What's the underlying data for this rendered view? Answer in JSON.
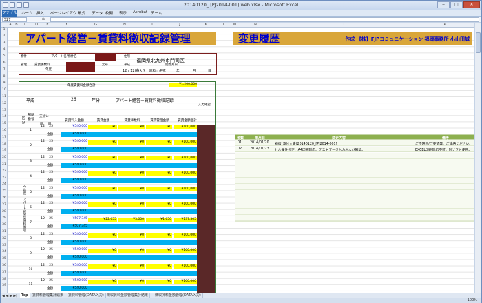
{
  "window": {
    "title": "20140120_ [PJ2014-001] web.xlsx - Microsoft Excel"
  },
  "menu": {
    "file": "ファイル",
    "items": [
      "ホーム",
      "挿入",
      "ページレイアウト",
      "数式",
      "データ",
      "校閲",
      "表示",
      "Acrobat",
      "チーム"
    ]
  },
  "formula_bar": {
    "name_box": "S27",
    "fx": "fx",
    "value": ""
  },
  "columns": [
    "A",
    "B",
    "C",
    "D",
    "E",
    "F",
    "G",
    "H",
    "I",
    "J",
    "K",
    "L",
    "M",
    "N",
    "O",
    "P"
  ],
  "rows": [
    "1",
    "2",
    "3",
    "4",
    "5",
    "6",
    "7",
    "8",
    "9",
    "10",
    "11",
    "12",
    "13",
    "14",
    "15",
    "16",
    "17",
    "18",
    "19",
    "20",
    "21",
    "22",
    "23",
    "24",
    "25",
    "26",
    "27",
    "28",
    "29",
    "30",
    "31",
    "32",
    "33",
    "34",
    "35",
    "36",
    "37",
    "38",
    "39"
  ],
  "sheet": {
    "title_left": "アパート経営－賃貸料徴収記録管理",
    "title_right": "変更履歴",
    "author": "作成 【株】FJPコミュニケーション 福岡事務所 小山田誠",
    "info": {
      "property_label": "物件",
      "property_name": "アパート名/物件名",
      "address_label": "住所",
      "address": "福岡県北九州市門司区",
      "mgmt_label": "管理",
      "mgmt_fee_label": "賃貸手数料",
      "year_label": "年度",
      "era_label": "元号",
      "era_value": "平成",
      "start_label": "開始月日",
      "date_value": "12 / 12(金)",
      "era_options": "□大正 □昭和 □平成",
      "year_word": "年",
      "month_word": "月",
      "day_word": "日"
    },
    "total_label": "年度賃貸料金額合計",
    "total_value": "¥1,200,000",
    "era": "平成",
    "year": "26",
    "year_unit": "年分",
    "subtitle": "アパート経営－賃貸料徴収記録",
    "input_check": "入力確認",
    "headers": {
      "kubun": "区分",
      "room": "部屋番号",
      "payment": "支払い",
      "month": "月",
      "day": "日",
      "rent_amount": "賃貸料入金額",
      "rent_fee": "賃貸金額",
      "fee": "賃貸手数料",
      "mgmt_fee": "賃貸管理金額",
      "rent_total": "賃貸金額合計"
    },
    "side_label": "今年度－アパート経営賃貸料徴収",
    "table_rows": [
      {
        "room": "1",
        "m": "12",
        "d": "25",
        "top": "¥540,000",
        "a": "¥0",
        "b": "¥0",
        "c": "¥0",
        "total": "¥100,000"
      },
      {
        "room": "2",
        "m": "12",
        "d": "25",
        "top": "¥540,000",
        "a": "¥0",
        "b": "¥0",
        "c": "¥0",
        "total": "¥100,000"
      },
      {
        "room": "3",
        "m": "12",
        "d": "25",
        "top": "¥540,000",
        "a": "¥0",
        "b": "¥0",
        "c": "¥0",
        "total": "¥100,000"
      },
      {
        "room": "4",
        "m": "12",
        "d": "25",
        "top": "¥540,000",
        "a": "¥0",
        "b": "¥0",
        "c": "¥0",
        "total": "¥100,000"
      },
      {
        "room": "5",
        "m": "12",
        "d": "25",
        "top": "¥540,000",
        "a": "¥0",
        "b": "¥0",
        "c": "¥0",
        "total": "¥100,000"
      },
      {
        "room": "6",
        "m": "12",
        "d": "25",
        "top": "¥540,000",
        "a": "¥0",
        "b": "¥0",
        "c": "¥0",
        "total": "¥100,000"
      },
      {
        "room": "7",
        "m": "12",
        "d": "25",
        "top": "¥507,345",
        "a": "¥22,655",
        "b": "¥3,000",
        "c": "¥1,650",
        "total": "¥137,305"
      },
      {
        "room": "8",
        "m": "12",
        "d": "25",
        "top": "¥540,000",
        "a": "¥0",
        "b": "¥0",
        "c": "¥0",
        "total": "¥100,000"
      },
      {
        "room": "9",
        "m": "12",
        "d": "25",
        "top": "¥540,000",
        "a": "¥0",
        "b": "¥0",
        "c": "¥0",
        "total": "¥100,000"
      },
      {
        "room": "10",
        "m": "12",
        "d": "25",
        "top": "¥540,000",
        "a": "¥0",
        "b": "¥0",
        "c": "¥0",
        "total": "¥100,000"
      },
      {
        "room": "11",
        "m": "12",
        "d": "25",
        "top": "¥540,000",
        "a": "¥0",
        "b": "¥0",
        "c": "¥0",
        "total": "¥100,000"
      }
    ],
    "amount_label": "金額",
    "history_headers": [
      "条数",
      "年月日",
      "変更内容",
      "備考"
    ],
    "history_rows": [
      {
        "no": "01",
        "date": "2014/01/20",
        "content": "初版(添付文書)20140120_[PJ2014-001]",
        "note": "ご不明点/ご要望等、ご連絡ください。"
      },
      {
        "no": "02",
        "date": "2014/01/23",
        "content": "セル属性修正、A4印刷対応、テストデータ入力および確認。",
        "note": "EXCEL印刷対応不可。別ソフト使用。"
      }
    ]
  },
  "tabs": {
    "nav": "◀ ◀ ▶ ▶|",
    "items": [
      "Top",
      "賃貸料管理集計結果",
      "賃貸料管理(DATA入力)",
      "徴収賃料金額管理集計結果",
      "徴収賃料金額管理(DATA入力)"
    ]
  },
  "status": {
    "zoom": "100%"
  },
  "colors": {
    "title_bg": "#d9a63a",
    "title_fg": "#0000cc",
    "accent_yellow": "#ffff00",
    "accent_cyan": "#00b0f0",
    "maroon": "#7a1818",
    "history_header": "#8db04f"
  }
}
